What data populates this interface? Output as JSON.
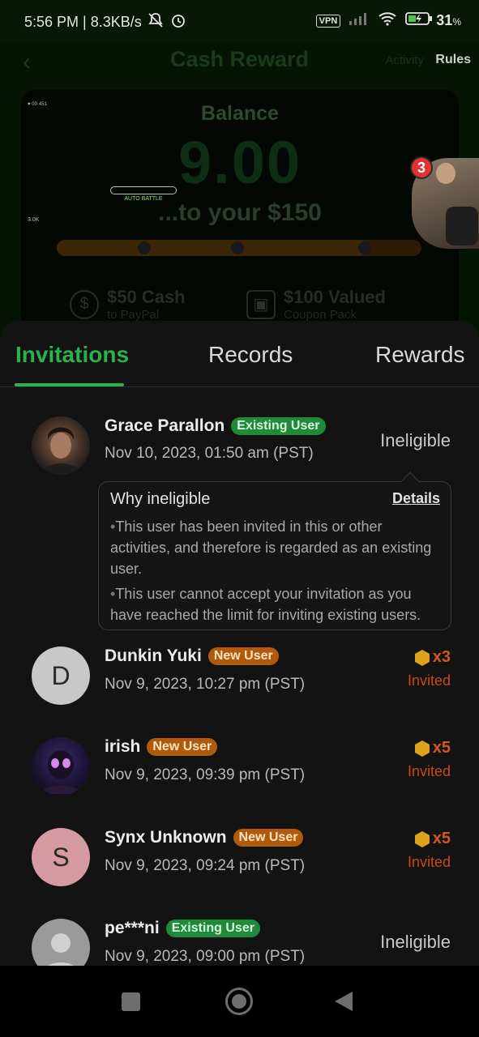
{
  "status_bar": {
    "time_speed": "5:56 PM | 8.3KB/s",
    "vpn": "VPN",
    "battery": "31",
    "battery_unit": "%"
  },
  "background": {
    "title": "Cash Reward",
    "activity": "Activity",
    "rules": "Rules",
    "balance_label": "Balance",
    "balance_value": "9.00",
    "headline": "r your $150",
    "headline_visible": "...to your $150",
    "game_label": "AUTO BATTLE",
    "reward_1_main": "$50 Cash",
    "reward_1_sub": "to PayPal",
    "reward_2_main": "$100 Valued",
    "reward_2_sub": "Coupon Pack",
    "float_badge_count": "3"
  },
  "tabs": [
    {
      "label": "Invitations",
      "active": true
    },
    {
      "label": "Records",
      "active": false
    },
    {
      "label": "Rewards",
      "active": false
    }
  ],
  "invitations": [
    {
      "name": "Grace Parallon",
      "badge": "Existing User",
      "date": "Nov 10, 2023, 01:50 am (PST)",
      "status": "Ineligible",
      "avatar": "photo"
    },
    {
      "name": "Dunkin Yuki",
      "badge": "New User",
      "date": "Nov 9, 2023, 10:27 pm (PST)",
      "reward": "x3",
      "status": "Invited",
      "avatar_letter": "D"
    },
    {
      "name": "irish",
      "badge": "New User",
      "date": "Nov 9, 2023, 09:39 pm (PST)",
      "reward": "x5",
      "status": "Invited",
      "avatar": "photo"
    },
    {
      "name": "Synx Unknown",
      "badge": "New User",
      "date": "Nov 9, 2023, 09:24 pm (PST)",
      "reward": "x5",
      "status": "Invited",
      "avatar_letter": "S"
    },
    {
      "name": "pe***ni",
      "badge": "Existing User",
      "date": "Nov 9, 2023, 09:00 pm (PST)",
      "status": "Ineligible",
      "avatar": "default"
    }
  ],
  "tooltip": {
    "title": "Why ineligible",
    "details": "Details",
    "reason_1": "This user has been invited in this or other activities, and therefore is regarded as an existing user.",
    "reason_2": "This user cannot accept your invitation as you have reached the limit for inviting existing users."
  },
  "colors": {
    "accent_green": "#2ab34a",
    "existing_badge": "#1e8a3a",
    "new_badge": "#b05a0e",
    "invited_orange": "#c84a16",
    "coin_gold": "#d9a21b"
  }
}
